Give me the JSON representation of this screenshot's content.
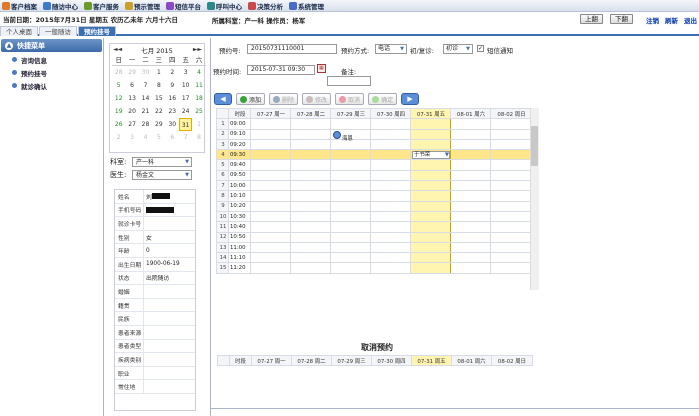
{
  "menu": [
    {
      "label": "客户档案",
      "icon": "folder-icon",
      "color": "#e07a2a"
    },
    {
      "label": "随访中心",
      "icon": "phone-icon",
      "color": "#3a7ac8"
    },
    {
      "label": "客户服务",
      "icon": "service-icon",
      "color": "#6a9a2a"
    },
    {
      "label": "预示管理",
      "icon": "warning-icon",
      "color": "#c8a02a"
    },
    {
      "label": "短信平台",
      "icon": "sms-icon",
      "color": "#8a4ac8"
    },
    {
      "label": "呼叫中心",
      "icon": "call-icon",
      "color": "#2a8a8a"
    },
    {
      "label": "决策分析",
      "icon": "chart-icon",
      "color": "#c84a4a"
    },
    {
      "label": "系统管理",
      "icon": "gear-icon",
      "color": "#4a6ac8"
    }
  ],
  "info": {
    "date": "当前日期：2015年7月31日 星期五 农历乙未年 六月十六日",
    "user": "所属科室：产一科 操作员：杨军"
  },
  "nav": {
    "prev": "上翻",
    "next": "下翻"
  },
  "links": {
    "logout": "注销",
    "refresh": "刷新",
    "exit": "退出"
  },
  "tabs": [
    {
      "label": "个人桌面",
      "active": false
    },
    {
      "label": "一般随访",
      "active": false
    },
    {
      "label": "预约挂号",
      "active": true
    }
  ],
  "sidebar": {
    "title": "快捷菜单",
    "items": [
      "咨询信息",
      "预约挂号",
      "就诊确认"
    ]
  },
  "calendar": {
    "month_label": "七月 2015",
    "prev": "◄ ◄",
    "next": "► ►",
    "weekdays": [
      "日",
      "一",
      "二",
      "三",
      "四",
      "五",
      "六"
    ],
    "weeks": [
      [
        {
          "d": "28",
          "o": true
        },
        {
          "d": "29",
          "o": true
        },
        {
          "d": "30",
          "o": true
        },
        {
          "d": "1"
        },
        {
          "d": "2"
        },
        {
          "d": "3"
        },
        {
          "d": "4"
        }
      ],
      [
        {
          "d": "5"
        },
        {
          "d": "6"
        },
        {
          "d": "7"
        },
        {
          "d": "8"
        },
        {
          "d": "9"
        },
        {
          "d": "10"
        },
        {
          "d": "11"
        }
      ],
      [
        {
          "d": "12"
        },
        {
          "d": "13"
        },
        {
          "d": "14"
        },
        {
          "d": "15"
        },
        {
          "d": "16"
        },
        {
          "d": "17"
        },
        {
          "d": "18"
        }
      ],
      [
        {
          "d": "19"
        },
        {
          "d": "20"
        },
        {
          "d": "21"
        },
        {
          "d": "22"
        },
        {
          "d": "23"
        },
        {
          "d": "24"
        },
        {
          "d": "25"
        }
      ],
      [
        {
          "d": "26"
        },
        {
          "d": "27"
        },
        {
          "d": "28"
        },
        {
          "d": "29"
        },
        {
          "d": "30"
        },
        {
          "d": "31",
          "t": true
        },
        {
          "d": "1",
          "o": true
        }
      ],
      [
        {
          "d": "2",
          "o": true
        },
        {
          "d": "3",
          "o": true
        },
        {
          "d": "4",
          "o": true
        },
        {
          "d": "5",
          "o": true
        },
        {
          "d": "6",
          "o": true
        },
        {
          "d": "7",
          "o": true
        },
        {
          "d": "8",
          "o": true
        }
      ]
    ]
  },
  "dept": {
    "label": "科室:",
    "value": "产一科"
  },
  "doctor": {
    "label": "医生:",
    "value": "杨金文"
  },
  "patient": [
    {
      "k": "姓名",
      "v": "刘",
      "redact": 18
    },
    {
      "k": "手机号码",
      "v": "",
      "redact": 28
    },
    {
      "k": "就诊卡号",
      "v": ""
    },
    {
      "k": "性别",
      "v": "女"
    },
    {
      "k": "年龄",
      "v": "0"
    },
    {
      "k": "出生日期",
      "v": "1900-06-19"
    },
    {
      "k": "状态",
      "v": "出院随访"
    },
    {
      "k": "婚姻",
      "v": ""
    },
    {
      "k": "籍贯",
      "v": ""
    },
    {
      "k": "民族",
      "v": ""
    },
    {
      "k": "患者来源",
      "v": ""
    },
    {
      "k": "患者类型",
      "v": ""
    },
    {
      "k": "疾病类别",
      "v": ""
    },
    {
      "k": "职业",
      "v": ""
    },
    {
      "k": "常住地",
      "v": ""
    }
  ],
  "form": {
    "id_label": "预约号:",
    "id_value": "20150731110001",
    "method_label": "预约方式:",
    "method_value": "电话",
    "visit_label": "初/复诊:",
    "visit_value": "初诊",
    "sms_label": "短信通知",
    "time_label": "预约时间:",
    "time_value": "2015-07-31 09:30",
    "note_label": "备注:",
    "note_value": ""
  },
  "toolbar": {
    "add": "添加",
    "delete": "删除",
    "edit": "修改",
    "cancel": "取消",
    "confirm": "确定"
  },
  "grid": {
    "headers": [
      "",
      "时段",
      "07-27 周一",
      "07-28 周二",
      "07-29 周三",
      "07-30 周四",
      "07-31 周五",
      "08-01 周六",
      "08-02 周日"
    ],
    "rows": [
      {
        "n": "1",
        "t": "09:00"
      },
      {
        "n": "2",
        "t": "09:10"
      },
      {
        "n": "3",
        "t": "09:20"
      },
      {
        "n": "4",
        "t": "09:30",
        "hl": true,
        "sel": "于书荣"
      },
      {
        "n": "5",
        "t": "09:40"
      },
      {
        "n": "6",
        "t": "09:50"
      },
      {
        "n": "7",
        "t": "10:00"
      },
      {
        "n": "8",
        "t": "10:10"
      },
      {
        "n": "9",
        "t": "10:20"
      },
      {
        "n": "10",
        "t": "10:30"
      },
      {
        "n": "11",
        "t": "10:40"
      },
      {
        "n": "12",
        "t": "10:50"
      },
      {
        "n": "13",
        "t": "11:00"
      },
      {
        "n": "14",
        "t": "11:10"
      },
      {
        "n": "15",
        "t": "11:20"
      }
    ],
    "tooltip": "海恩"
  },
  "cancel_section": {
    "title": "取消预约",
    "headers": [
      "",
      "时段",
      "07-27 周一",
      "07-28 周二",
      "07-29 周三",
      "07-30 周四",
      "07-31 周五",
      "08-01 周六",
      "08-02 周日"
    ]
  }
}
